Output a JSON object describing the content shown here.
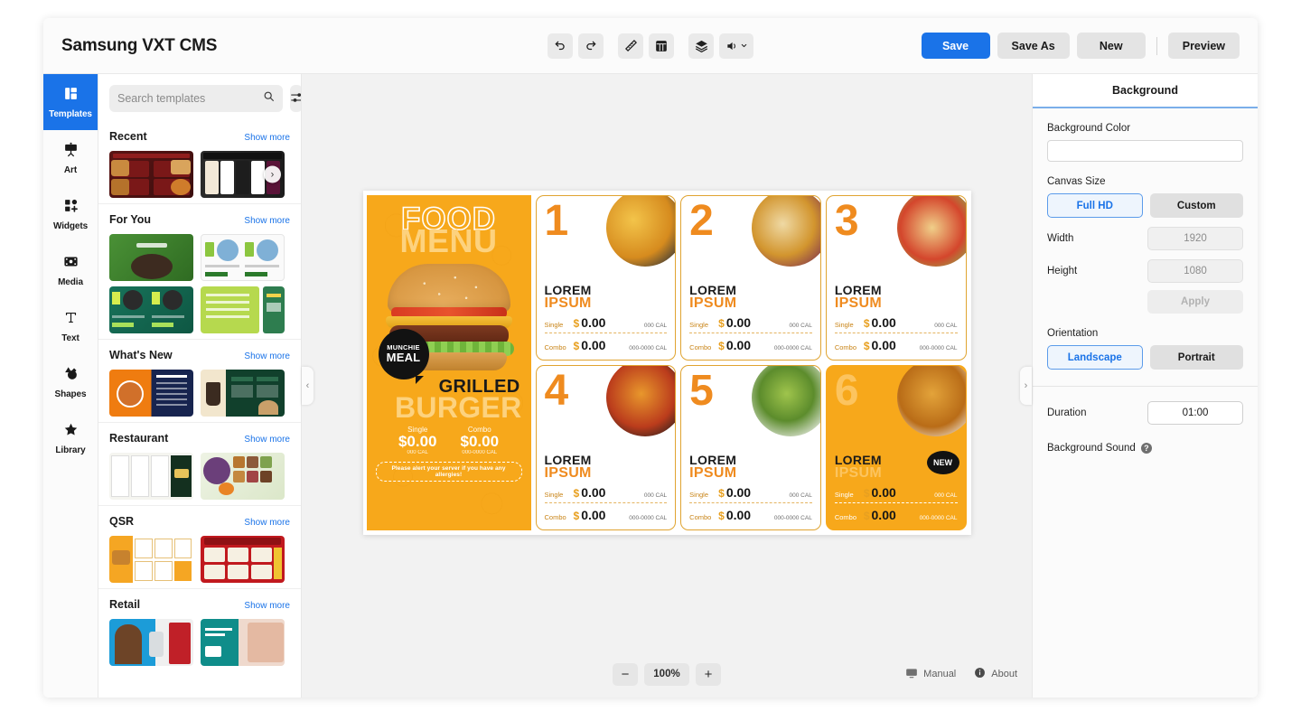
{
  "app": {
    "title": "Samsung VXT CMS"
  },
  "header": {
    "tools": [
      {
        "name": "undo-icon",
        "label": "Undo"
      },
      {
        "name": "redo-icon",
        "label": "Redo"
      },
      {
        "name": "ruler-icon",
        "label": "Ruler"
      },
      {
        "name": "grid-icon",
        "label": "Grid"
      },
      {
        "name": "layers-icon",
        "label": "Layers"
      },
      {
        "name": "volume-icon",
        "label": "Volume"
      }
    ],
    "save_label": "Save",
    "save_as_label": "Save As",
    "new_label": "New",
    "preview_label": "Preview",
    "accent_color": "#1a73e8"
  },
  "rail": {
    "items": [
      {
        "label": "Templates",
        "icon": "templates-icon",
        "active": true
      },
      {
        "label": "Art",
        "icon": "art-icon",
        "active": false
      },
      {
        "label": "Widgets",
        "icon": "widgets-icon",
        "active": false
      },
      {
        "label": "Media",
        "icon": "media-icon",
        "active": false
      },
      {
        "label": "Text",
        "icon": "text-icon",
        "active": false
      },
      {
        "label": "Shapes",
        "icon": "shapes-icon",
        "active": false
      },
      {
        "label": "Library",
        "icon": "library-icon",
        "active": false
      }
    ]
  },
  "templates": {
    "search_placeholder": "Search templates",
    "search_value": "",
    "show_more_label": "Show more",
    "sections": [
      {
        "title": "Recent"
      },
      {
        "title": "For You"
      },
      {
        "title": "What's New"
      },
      {
        "title": "Restaurant"
      },
      {
        "title": "QSR"
      },
      {
        "title": "Retail"
      }
    ]
  },
  "canvas": {
    "hero": {
      "food": "FOOD",
      "menu": "MENU",
      "badge_top": "MUNCHIE",
      "badge_bottom": "MEAL",
      "name_top": "GRILLED",
      "name_bottom": "BURGER",
      "single_label": "Single",
      "single_price": "$0.00",
      "single_cal": "000 CAL",
      "combo_label": "Combo",
      "combo_price": "$0.00",
      "combo_cal": "000-0000 CAL",
      "allergy_note": "Please alert your server if you have any allergies!"
    },
    "item_labels": {
      "single": "Single",
      "combo": "Combo",
      "currency": "$",
      "price": "0.00",
      "single_cal": "000 CAL",
      "combo_cal": "000-0000 CAL"
    },
    "items": [
      {
        "number": "1",
        "name_top": "LOREM",
        "name_bottom": "IPSUM",
        "photo": "p-taco",
        "accent": false,
        "badge": ""
      },
      {
        "number": "2",
        "name_top": "LOREM",
        "name_bottom": "IPSUM",
        "photo": "p-wrap",
        "accent": false,
        "badge": ""
      },
      {
        "number": "3",
        "name_top": "LOREM",
        "name_bottom": "IPSUM",
        "photo": "p-dog",
        "accent": false,
        "badge": ""
      },
      {
        "number": "4",
        "name_top": "LOREM",
        "name_bottom": "IPSUM",
        "photo": "p-pizza",
        "accent": false,
        "badge": ""
      },
      {
        "number": "5",
        "name_top": "LOREM",
        "name_bottom": "IPSUM",
        "photo": "p-salad",
        "accent": false,
        "badge": ""
      },
      {
        "number": "6",
        "name_top": "LOREM",
        "name_bottom": "IPSUM",
        "photo": "p-wing",
        "accent": true,
        "badge": "NEW"
      }
    ]
  },
  "bottom": {
    "zoom_out": "−",
    "zoom_level": "100%",
    "zoom_in": "+",
    "manual_label": "Manual",
    "about_label": "About"
  },
  "properties": {
    "tab_label": "Background",
    "background_color_label": "Background Color",
    "background_color_value": "",
    "canvas_size_label": "Canvas Size",
    "full_hd_label": "Full HD",
    "custom_label": "Custom",
    "width_label": "Width",
    "width_value": "1920",
    "height_label": "Height",
    "height_value": "1080",
    "apply_label": "Apply",
    "orientation_label": "Orientation",
    "landscape_label": "Landscape",
    "portrait_label": "Portrait",
    "duration_label": "Duration",
    "duration_value": "01:00",
    "background_sound_label": "Background Sound",
    "help_glyph": "?"
  },
  "handles": {
    "left": "‹",
    "right": "›"
  }
}
